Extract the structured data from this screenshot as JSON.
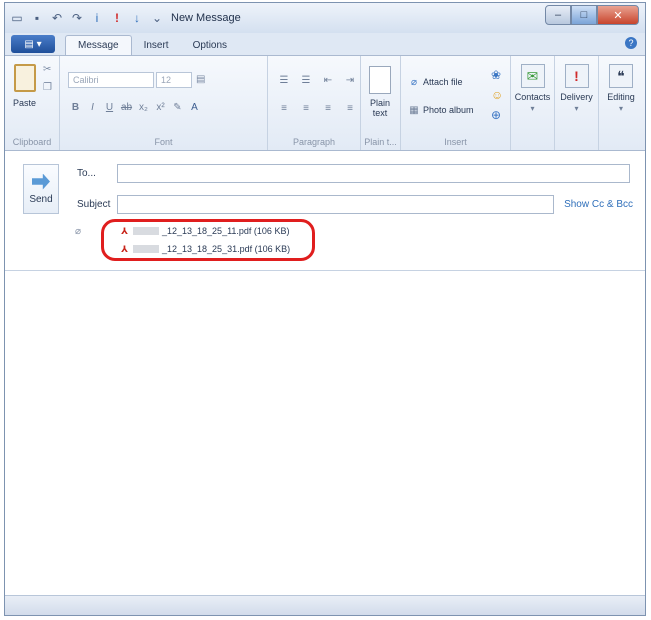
{
  "window": {
    "title": "New Message"
  },
  "tabs": [
    {
      "label": "Message",
      "active": true
    },
    {
      "label": "Insert",
      "active": false
    },
    {
      "label": "Options",
      "active": false
    }
  ],
  "ribbon": {
    "clipboard": {
      "paste_label": "Paste",
      "group_label": "Clipboard"
    },
    "font": {
      "font_name": "Calibri",
      "font_size": "12",
      "group_label": "Font"
    },
    "paragraph": {
      "group_label": "Paragraph"
    },
    "plain_text": {
      "label_line1": "Plain",
      "label_line2": "text",
      "group_label": "Plain t..."
    },
    "insert": {
      "attach_file": "Attach file",
      "photo_album": "Photo album",
      "group_label": "Insert"
    },
    "contacts": "Contacts",
    "delivery": "Delivery",
    "editing": "Editing"
  },
  "compose": {
    "send_label": "Send",
    "to_label": "To...",
    "to_value": "",
    "subject_label": "Subject",
    "subject_value": "",
    "show_cc_bcc": "Show Cc & Bcc",
    "attachments": [
      {
        "name": "_12_13_18_25_11.pdf (106 KB)"
      },
      {
        "name": "_12_13_18_25_31.pdf (106 KB)"
      }
    ]
  },
  "colors": {
    "highlight": "#e01e1e",
    "link": "#2f6fba"
  }
}
